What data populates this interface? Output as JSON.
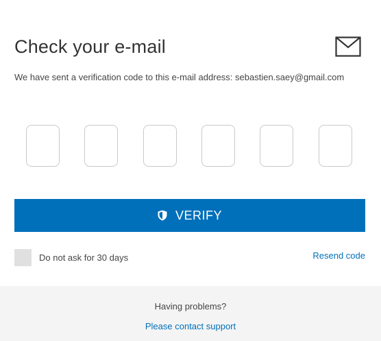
{
  "header": {
    "title": "Check your e-mail",
    "icon": "envelope-icon"
  },
  "message": {
    "text": "We have sent a verification code to this e-mail address: sebastien.saey@gmail.com"
  },
  "code_inputs": [
    {
      "value": ""
    },
    {
      "value": ""
    },
    {
      "value": ""
    },
    {
      "value": ""
    },
    {
      "value": ""
    },
    {
      "value": ""
    }
  ],
  "verify_button": {
    "label": "VERIFY",
    "icon": "shield-icon"
  },
  "remember": {
    "label": "Do not ask for 30 days",
    "checked": false
  },
  "resend_link": {
    "label": "Resend code"
  },
  "footer": {
    "question": "Having problems?",
    "link_label": "Please contact support"
  },
  "colors": {
    "accent": "#0070ba",
    "footer_bg": "#f4f4f4",
    "checkbox_bg": "#e0e0e0"
  }
}
